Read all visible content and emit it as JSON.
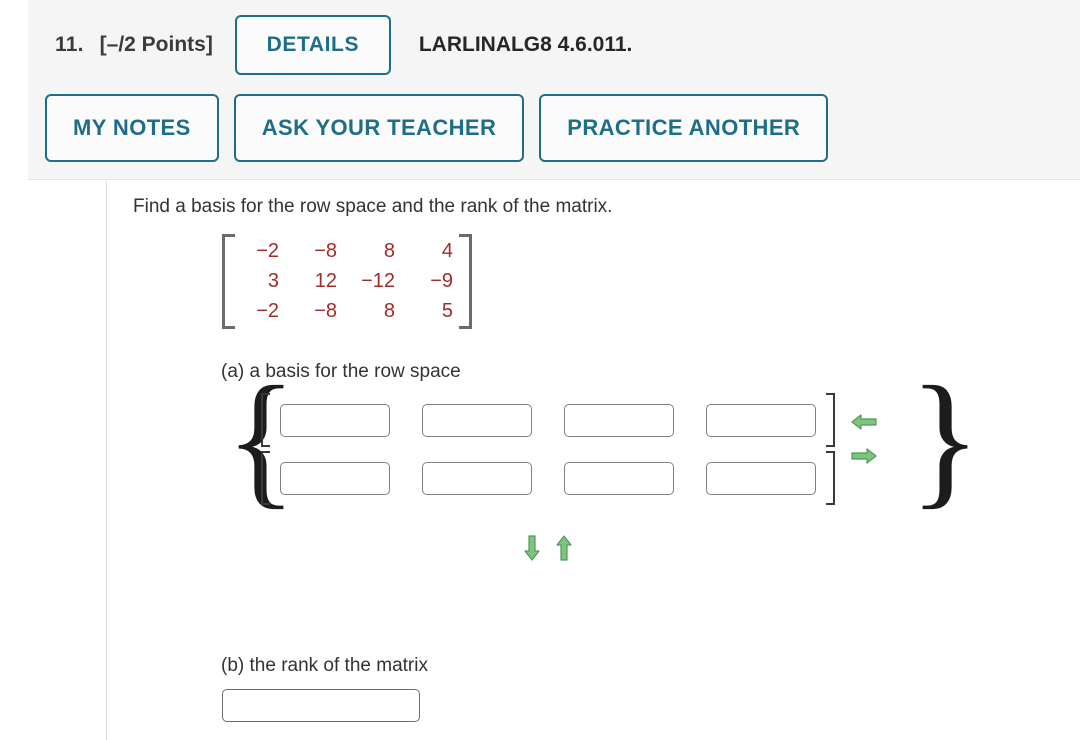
{
  "header": {
    "question_number": "11.",
    "points": "[–/2 Points]",
    "details_label": "DETAILS",
    "problem_code": "LARLINALG8 4.6.011.",
    "buttons": [
      {
        "label": "MY NOTES"
      },
      {
        "label": "ASK YOUR TEACHER"
      },
      {
        "label": "PRACTICE ANOTHER"
      }
    ]
  },
  "body": {
    "prompt": "Find a basis for the row space and the rank of the matrix.",
    "matrix": {
      "rows": [
        [
          "−2",
          "−8",
          "8",
          "4"
        ],
        [
          "3",
          "12",
          "−12",
          "−9"
        ],
        [
          "−2",
          "−8",
          "8",
          "5"
        ]
      ],
      "text_color": "#a02c2c",
      "bracket_color": "#6b6b6b"
    },
    "part_a": {
      "label": "(a) a basis for the row space",
      "vector_rows": [
        {
          "cells": [
            {
              "value": "",
              "placeholder": ""
            },
            {
              "value": "",
              "placeholder": ""
            },
            {
              "value": "",
              "placeholder": ""
            },
            {
              "value": "",
              "placeholder": ""
            }
          ]
        },
        {
          "cells": [
            {
              "value": "",
              "placeholder": ""
            },
            {
              "value": "",
              "placeholder": ""
            },
            {
              "value": "",
              "placeholder": ""
            },
            {
              "value": "",
              "placeholder": ""
            }
          ]
        }
      ],
      "side_arrows": [
        {
          "icon": "arrow-left-icon",
          "direction": "left",
          "color": "#6fbf73"
        },
        {
          "icon": "arrow-right-icon",
          "direction": "right",
          "color": "#6fbf73"
        }
      ],
      "vertical_arrows": [
        {
          "icon": "arrow-down-icon",
          "direction": "down",
          "color": "#6fbf73"
        },
        {
          "icon": "arrow-up-icon",
          "direction": "up",
          "color": "#6fbf73"
        }
      ],
      "open_brace": "{",
      "close_brace": "}"
    },
    "part_b": {
      "label": "(b) the rank of the matrix",
      "answer": {
        "value": "",
        "placeholder": ""
      }
    }
  },
  "colors": {
    "panel_background": "#f5f5f5",
    "accent_teal": "#1f6e87",
    "text_dark": "#333333",
    "arrow_green": "#6fbf73",
    "divider": "#dcdcdc"
  }
}
